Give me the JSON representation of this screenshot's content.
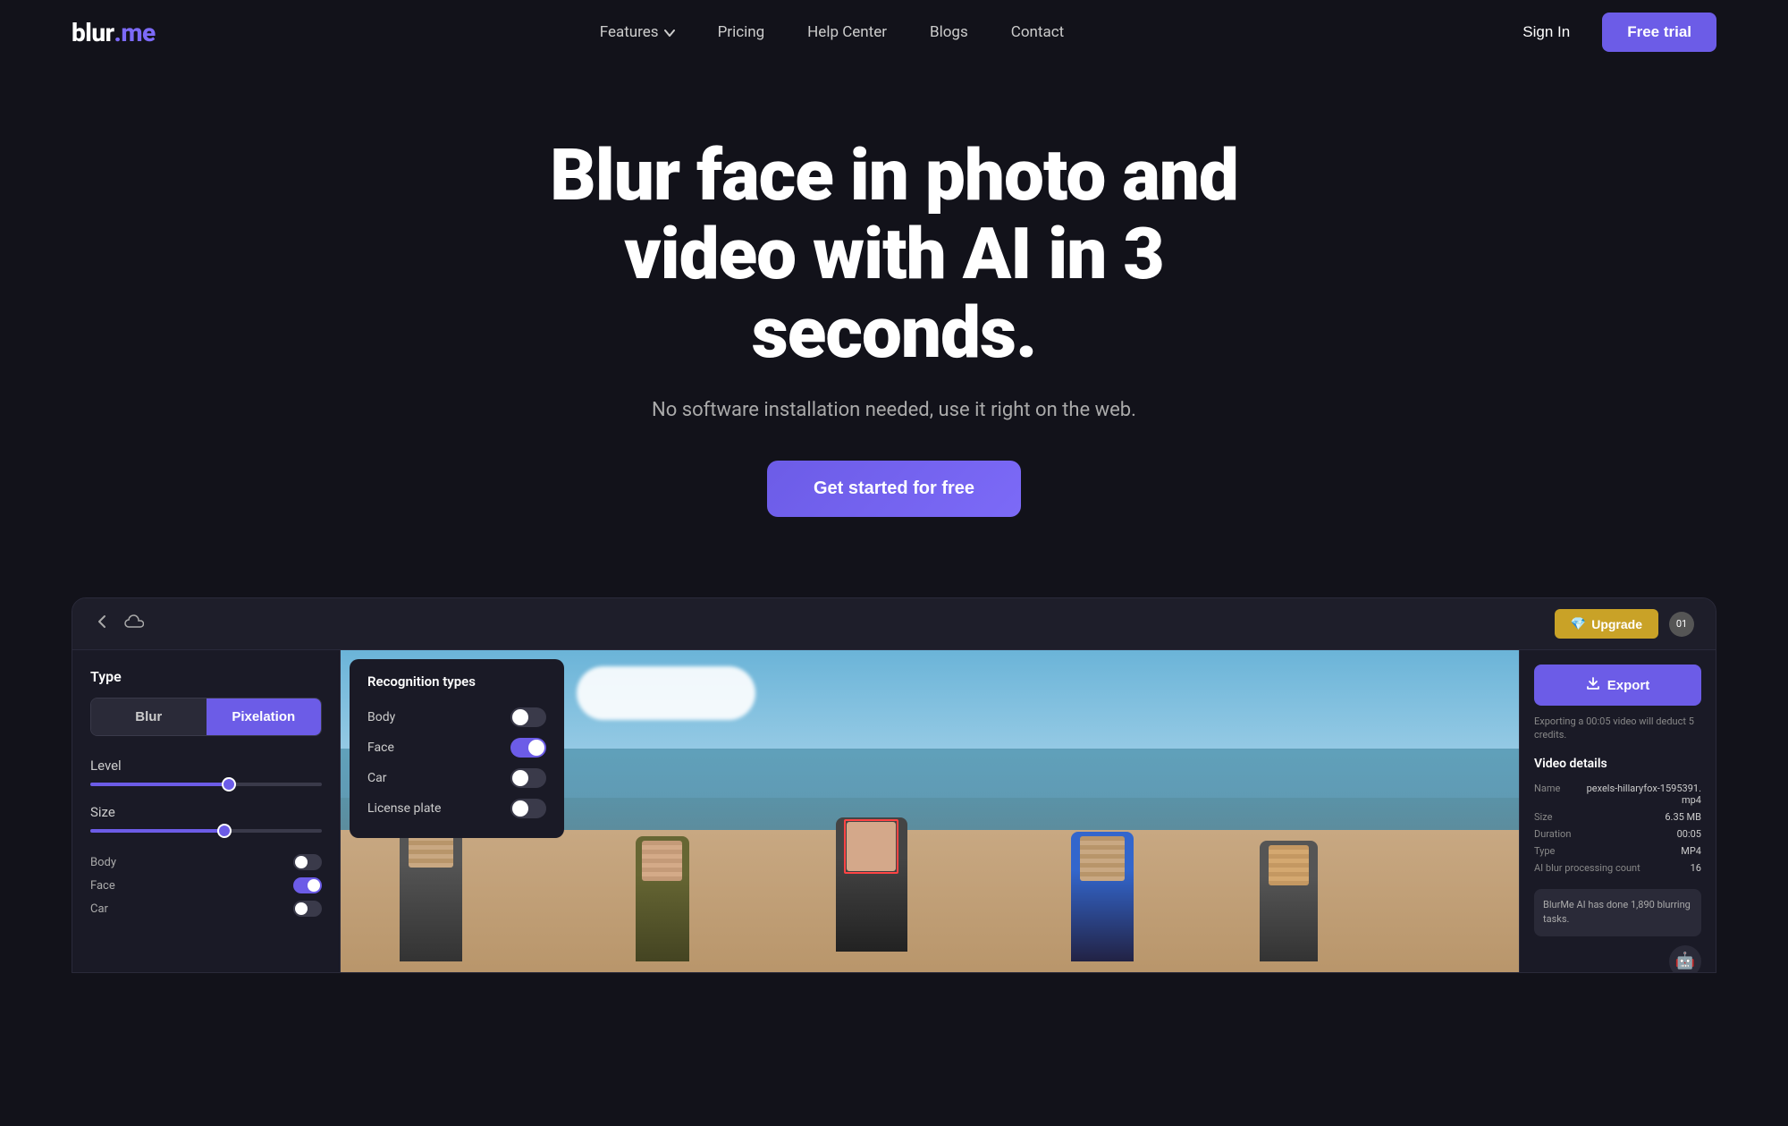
{
  "brand": {
    "blur": "blur",
    "dotme": ".me"
  },
  "nav": {
    "features_label": "Features",
    "pricing_label": "Pricing",
    "help_center_label": "Help Center",
    "blogs_label": "Blogs",
    "contact_label": "Contact",
    "sign_in_label": "Sign In",
    "free_trial_label": "Free trial"
  },
  "hero": {
    "title": "Blur face in photo and video with AI in 3 seconds.",
    "subtitle": "No software installation needed, use it right on the web.",
    "cta_label": "Get started for free"
  },
  "app": {
    "topbar": {
      "upgrade_label": "Upgrade",
      "avatar_initials": "01"
    },
    "left_panel": {
      "type_label": "Type",
      "blur_btn": "Blur",
      "pixelation_btn": "Pixelation",
      "level_label": "Level",
      "size_label": "Size",
      "body_label": "Body",
      "face_label": "Face",
      "car_label": "Car"
    },
    "recognition_panel": {
      "title": "Recognition types",
      "body_label": "Body",
      "face_label": "Face",
      "car_label": "Car",
      "license_plate_label": "License plate"
    },
    "right_panel": {
      "export_label": "Export",
      "export_note": "Exporting a 00:05 video will deduct 5 credits.",
      "video_details_title": "Video details",
      "name_key": "Name",
      "name_val": "pexels-hillaryfox-1595391.mp4",
      "size_key": "Size",
      "size_val": "6.35 MB",
      "duration_key": "Duration",
      "duration_val": "00:05",
      "type_key": "Type",
      "type_val": "MP4",
      "ai_count_key": "AI blur processing count",
      "ai_count_val": "16",
      "ai_message": "BlurMe AI has done 1,890 blurring tasks."
    }
  }
}
